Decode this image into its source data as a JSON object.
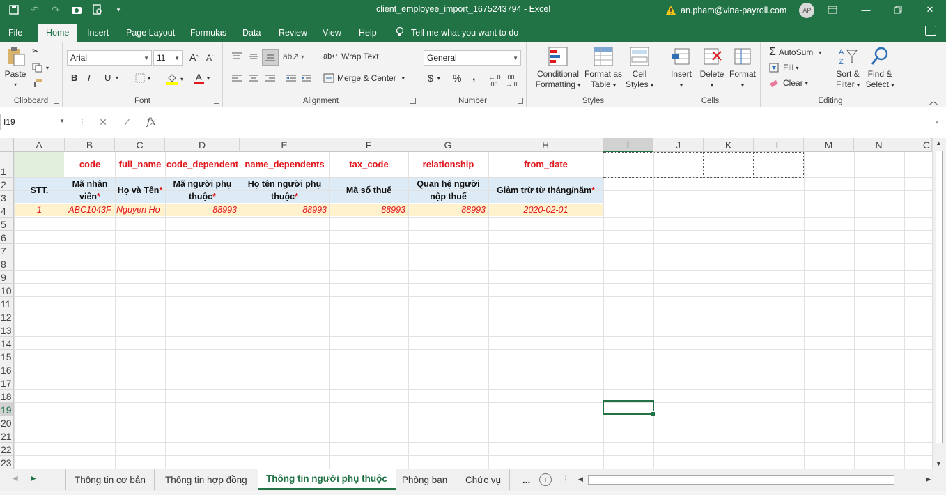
{
  "app": {
    "title": "client_employee_import_1675243794  -  Excel",
    "user_email": "an.pham@vina-payroll.com",
    "user_initials": "AP",
    "accent_color": "#217346"
  },
  "menu": {
    "tabs": [
      "File",
      "Home",
      "Insert",
      "Page Layout",
      "Formulas",
      "Data",
      "Review",
      "View",
      "Help"
    ],
    "active": "Home",
    "tell_me": "Tell me what you want to do"
  },
  "ribbon": {
    "clipboard": {
      "label": "Clipboard",
      "paste": "Paste"
    },
    "font": {
      "label": "Font",
      "name": "Arial",
      "size": "11",
      "bold": "B",
      "italic": "I",
      "underline": "U"
    },
    "alignment": {
      "label": "Alignment",
      "wrap_text": "Wrap Text",
      "merge_center": "Merge & Center"
    },
    "number": {
      "label": "Number",
      "format": "General",
      "currency": "$",
      "percent": "%",
      "comma": ","
    },
    "styles": {
      "label": "Styles",
      "conditional_1": "Conditional",
      "conditional_2": "Formatting",
      "format_table_1": "Format as",
      "format_table_2": "Table",
      "cell_styles_1": "Cell",
      "cell_styles_2": "Styles"
    },
    "cells": {
      "label": "Cells",
      "insert": "Insert",
      "delete": "Delete",
      "format": "Format"
    },
    "editing": {
      "label": "Editing",
      "autosum": "AutoSum",
      "fill": "Fill",
      "clear": "Clear",
      "sort_1": "Sort &",
      "sort_2": "Filter",
      "find_1": "Find &",
      "find_2": "Select"
    }
  },
  "formula_bar": {
    "name_box": "I19",
    "fx": "fx",
    "value": ""
  },
  "grid": {
    "columns": [
      "A",
      "B",
      "C",
      "D",
      "E",
      "F",
      "G",
      "H",
      "I",
      "J",
      "K",
      "L",
      "M",
      "N",
      "C"
    ],
    "selected_column": "I",
    "rows": [
      "1",
      "2",
      "3",
      "4",
      "5",
      "6",
      "7",
      "8",
      "9",
      "10",
      "11",
      "12",
      "13",
      "14",
      "15",
      "16",
      "17",
      "18",
      "19",
      "20",
      "21",
      "22",
      "23"
    ],
    "selected_row": "19",
    "row1": [
      "code",
      "full_name",
      "code_dependent",
      "name_dependents",
      "tax_code",
      "relationship",
      "from_date"
    ],
    "row2": {
      "a": "STT.",
      "b": "Mã nhân viên",
      "c": "Họ và Tên",
      "d": "Mã người phụ thuộc",
      "e": "Họ tên người phụ thuộc",
      "f": "Mã số thuế",
      "g": "Quan hệ người nộp thuế",
      "h": "Giảm trừ từ tháng/năm",
      "star": "*"
    },
    "row4": [
      "1",
      "ABC1043F",
      "Nguyen Ho",
      "88993",
      "88993",
      "88993",
      "88993",
      "2020-02-01"
    ]
  },
  "sheets": {
    "tabs": [
      "Thông tin cơ bản",
      "Thông tin hợp đồng",
      "Thông tin người phụ thuộc",
      "Phòng ban",
      "Chức vụ"
    ],
    "active": "Thông tin người phụ thuộc",
    "more": "..."
  }
}
